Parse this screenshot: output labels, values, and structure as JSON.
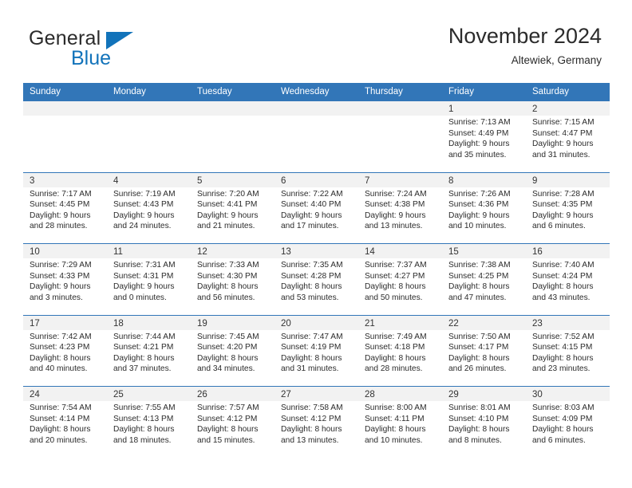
{
  "brand": {
    "word1": "General",
    "word2": "Blue",
    "flag_icon": "triangle-flag-icon",
    "accent_color": "#1273ba"
  },
  "header": {
    "title": "November 2024",
    "subtitle": "Altewiek, Germany"
  },
  "theme": {
    "header_bar": "#3276b8",
    "day_strip": "#f2f2f2",
    "text": "#2b2b2b"
  },
  "weekdays": [
    "Sunday",
    "Monday",
    "Tuesday",
    "Wednesday",
    "Thursday",
    "Friday",
    "Saturday"
  ],
  "weeks": [
    [
      {
        "day": "",
        "sunrise": "",
        "sunset": "",
        "daylight1": "",
        "daylight2": ""
      },
      {
        "day": "",
        "sunrise": "",
        "sunset": "",
        "daylight1": "",
        "daylight2": ""
      },
      {
        "day": "",
        "sunrise": "",
        "sunset": "",
        "daylight1": "",
        "daylight2": ""
      },
      {
        "day": "",
        "sunrise": "",
        "sunset": "",
        "daylight1": "",
        "daylight2": ""
      },
      {
        "day": "",
        "sunrise": "",
        "sunset": "",
        "daylight1": "",
        "daylight2": ""
      },
      {
        "day": "1",
        "sunrise": "Sunrise: 7:13 AM",
        "sunset": "Sunset: 4:49 PM",
        "daylight1": "Daylight: 9 hours",
        "daylight2": "and 35 minutes."
      },
      {
        "day": "2",
        "sunrise": "Sunrise: 7:15 AM",
        "sunset": "Sunset: 4:47 PM",
        "daylight1": "Daylight: 9 hours",
        "daylight2": "and 31 minutes."
      }
    ],
    [
      {
        "day": "3",
        "sunrise": "Sunrise: 7:17 AM",
        "sunset": "Sunset: 4:45 PM",
        "daylight1": "Daylight: 9 hours",
        "daylight2": "and 28 minutes."
      },
      {
        "day": "4",
        "sunrise": "Sunrise: 7:19 AM",
        "sunset": "Sunset: 4:43 PM",
        "daylight1": "Daylight: 9 hours",
        "daylight2": "and 24 minutes."
      },
      {
        "day": "5",
        "sunrise": "Sunrise: 7:20 AM",
        "sunset": "Sunset: 4:41 PM",
        "daylight1": "Daylight: 9 hours",
        "daylight2": "and 21 minutes."
      },
      {
        "day": "6",
        "sunrise": "Sunrise: 7:22 AM",
        "sunset": "Sunset: 4:40 PM",
        "daylight1": "Daylight: 9 hours",
        "daylight2": "and 17 minutes."
      },
      {
        "day": "7",
        "sunrise": "Sunrise: 7:24 AM",
        "sunset": "Sunset: 4:38 PM",
        "daylight1": "Daylight: 9 hours",
        "daylight2": "and 13 minutes."
      },
      {
        "day": "8",
        "sunrise": "Sunrise: 7:26 AM",
        "sunset": "Sunset: 4:36 PM",
        "daylight1": "Daylight: 9 hours",
        "daylight2": "and 10 minutes."
      },
      {
        "day": "9",
        "sunrise": "Sunrise: 7:28 AM",
        "sunset": "Sunset: 4:35 PM",
        "daylight1": "Daylight: 9 hours",
        "daylight2": "and 6 minutes."
      }
    ],
    [
      {
        "day": "10",
        "sunrise": "Sunrise: 7:29 AM",
        "sunset": "Sunset: 4:33 PM",
        "daylight1": "Daylight: 9 hours",
        "daylight2": "and 3 minutes."
      },
      {
        "day": "11",
        "sunrise": "Sunrise: 7:31 AM",
        "sunset": "Sunset: 4:31 PM",
        "daylight1": "Daylight: 9 hours",
        "daylight2": "and 0 minutes."
      },
      {
        "day": "12",
        "sunrise": "Sunrise: 7:33 AM",
        "sunset": "Sunset: 4:30 PM",
        "daylight1": "Daylight: 8 hours",
        "daylight2": "and 56 minutes."
      },
      {
        "day": "13",
        "sunrise": "Sunrise: 7:35 AM",
        "sunset": "Sunset: 4:28 PM",
        "daylight1": "Daylight: 8 hours",
        "daylight2": "and 53 minutes."
      },
      {
        "day": "14",
        "sunrise": "Sunrise: 7:37 AM",
        "sunset": "Sunset: 4:27 PM",
        "daylight1": "Daylight: 8 hours",
        "daylight2": "and 50 minutes."
      },
      {
        "day": "15",
        "sunrise": "Sunrise: 7:38 AM",
        "sunset": "Sunset: 4:25 PM",
        "daylight1": "Daylight: 8 hours",
        "daylight2": "and 47 minutes."
      },
      {
        "day": "16",
        "sunrise": "Sunrise: 7:40 AM",
        "sunset": "Sunset: 4:24 PM",
        "daylight1": "Daylight: 8 hours",
        "daylight2": "and 43 minutes."
      }
    ],
    [
      {
        "day": "17",
        "sunrise": "Sunrise: 7:42 AM",
        "sunset": "Sunset: 4:23 PM",
        "daylight1": "Daylight: 8 hours",
        "daylight2": "and 40 minutes."
      },
      {
        "day": "18",
        "sunrise": "Sunrise: 7:44 AM",
        "sunset": "Sunset: 4:21 PM",
        "daylight1": "Daylight: 8 hours",
        "daylight2": "and 37 minutes."
      },
      {
        "day": "19",
        "sunrise": "Sunrise: 7:45 AM",
        "sunset": "Sunset: 4:20 PM",
        "daylight1": "Daylight: 8 hours",
        "daylight2": "and 34 minutes."
      },
      {
        "day": "20",
        "sunrise": "Sunrise: 7:47 AM",
        "sunset": "Sunset: 4:19 PM",
        "daylight1": "Daylight: 8 hours",
        "daylight2": "and 31 minutes."
      },
      {
        "day": "21",
        "sunrise": "Sunrise: 7:49 AM",
        "sunset": "Sunset: 4:18 PM",
        "daylight1": "Daylight: 8 hours",
        "daylight2": "and 28 minutes."
      },
      {
        "day": "22",
        "sunrise": "Sunrise: 7:50 AM",
        "sunset": "Sunset: 4:17 PM",
        "daylight1": "Daylight: 8 hours",
        "daylight2": "and 26 minutes."
      },
      {
        "day": "23",
        "sunrise": "Sunrise: 7:52 AM",
        "sunset": "Sunset: 4:15 PM",
        "daylight1": "Daylight: 8 hours",
        "daylight2": "and 23 minutes."
      }
    ],
    [
      {
        "day": "24",
        "sunrise": "Sunrise: 7:54 AM",
        "sunset": "Sunset: 4:14 PM",
        "daylight1": "Daylight: 8 hours",
        "daylight2": "and 20 minutes."
      },
      {
        "day": "25",
        "sunrise": "Sunrise: 7:55 AM",
        "sunset": "Sunset: 4:13 PM",
        "daylight1": "Daylight: 8 hours",
        "daylight2": "and 18 minutes."
      },
      {
        "day": "26",
        "sunrise": "Sunrise: 7:57 AM",
        "sunset": "Sunset: 4:12 PM",
        "daylight1": "Daylight: 8 hours",
        "daylight2": "and 15 minutes."
      },
      {
        "day": "27",
        "sunrise": "Sunrise: 7:58 AM",
        "sunset": "Sunset: 4:12 PM",
        "daylight1": "Daylight: 8 hours",
        "daylight2": "and 13 minutes."
      },
      {
        "day": "28",
        "sunrise": "Sunrise: 8:00 AM",
        "sunset": "Sunset: 4:11 PM",
        "daylight1": "Daylight: 8 hours",
        "daylight2": "and 10 minutes."
      },
      {
        "day": "29",
        "sunrise": "Sunrise: 8:01 AM",
        "sunset": "Sunset: 4:10 PM",
        "daylight1": "Daylight: 8 hours",
        "daylight2": "and 8 minutes."
      },
      {
        "day": "30",
        "sunrise": "Sunrise: 8:03 AM",
        "sunset": "Sunset: 4:09 PM",
        "daylight1": "Daylight: 8 hours",
        "daylight2": "and 6 minutes."
      }
    ]
  ]
}
